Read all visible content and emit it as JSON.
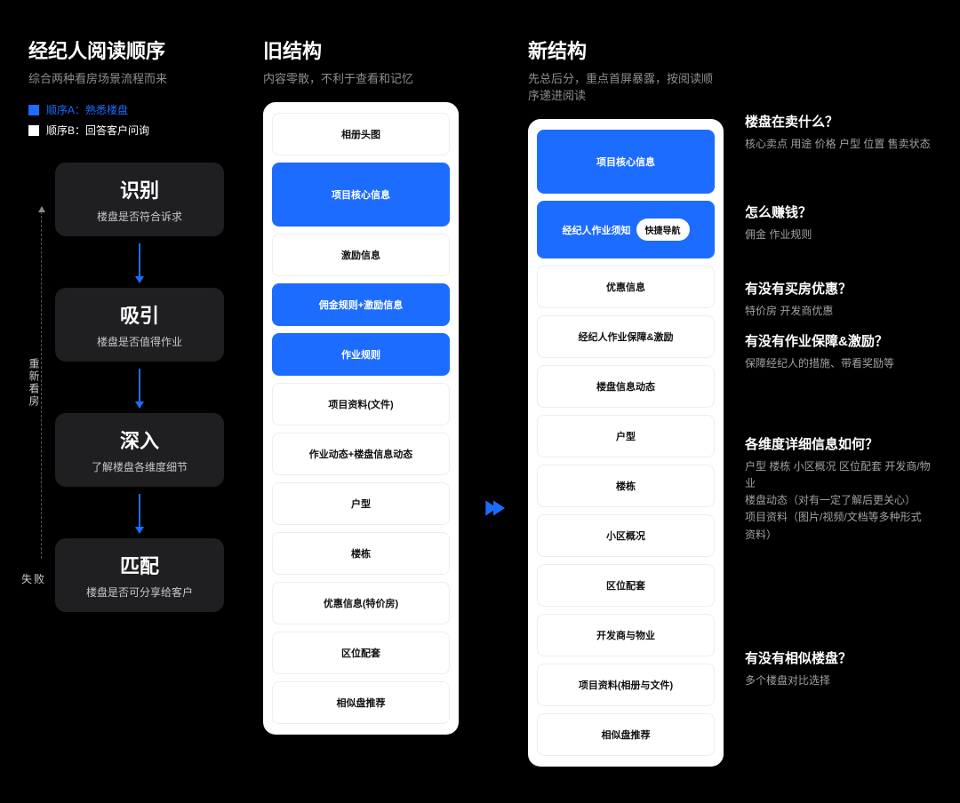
{
  "flow": {
    "title": "经纪人阅读顺序",
    "subtitle": "综合两种看房场景流程而来",
    "legend_a": "顺序A：熟悉楼盘",
    "legend_b": "顺序B：回答客户问询",
    "side_revisit": "重新看房",
    "side_fail": "失败",
    "nodes": [
      {
        "title": "识别",
        "desc": "楼盘是否符合诉求"
      },
      {
        "title": "吸引",
        "desc": "楼盘是否值得作业"
      },
      {
        "title": "深入",
        "desc": "了解楼盘各维度细节"
      },
      {
        "title": "匹配",
        "desc": "楼盘是否可分享给客户"
      }
    ]
  },
  "old": {
    "title": "旧结构",
    "subtitle": "内容零散，不利于查看和记忆",
    "items": [
      {
        "label": "相册头图",
        "style": "white"
      },
      {
        "label": "项目核心信息",
        "style": "blue-tall"
      },
      {
        "label": "激励信息",
        "style": "white"
      },
      {
        "label": "佣金规则+激励信息",
        "style": "blue"
      },
      {
        "label": "作业规则",
        "style": "blue"
      },
      {
        "label": "项目资料(文件)",
        "style": "white"
      },
      {
        "label": "作业动态+楼盘信息动态",
        "style": "white"
      },
      {
        "label": "户型",
        "style": "white"
      },
      {
        "label": "楼栋",
        "style": "white"
      },
      {
        "label": "优惠信息(特价房)",
        "style": "white"
      },
      {
        "label": "区位配套",
        "style": "white"
      },
      {
        "label": "相似盘推荐",
        "style": "white"
      }
    ]
  },
  "new": {
    "title": "新结构",
    "subtitle": "先总后分，重点首屏暴露，按阅读顺序递进阅读",
    "items": [
      {
        "label": "项目核心信息",
        "style": "blue-tall"
      },
      {
        "label": "经纪人作业须知",
        "style": "nav",
        "pill": "快捷导航"
      },
      {
        "label": "优惠信息",
        "style": "white"
      },
      {
        "label": "经纪人作业保障&激励",
        "style": "white"
      },
      {
        "label": "楼盘信息动态",
        "style": "white"
      },
      {
        "label": "户型",
        "style": "white"
      },
      {
        "label": "楼栋",
        "style": "white"
      },
      {
        "label": "小区概况",
        "style": "white"
      },
      {
        "label": "区位配套",
        "style": "white"
      },
      {
        "label": "开发商与物业",
        "style": "white"
      },
      {
        "label": "项目资料(相册与文件)",
        "style": "white"
      },
      {
        "label": "相似盘推荐",
        "style": "white"
      }
    ]
  },
  "questions": [
    {
      "title": "楼盘在卖什么？",
      "desc": "核心卖点 用途 价格 户型 位置 售卖状态",
      "sp": "q-sp-1"
    },
    {
      "title": "怎么赚钱？",
      "desc": "佣金 作业规则",
      "sp": "q-sp-2"
    },
    {
      "title": "有没有买房优惠？",
      "desc": "特价房 开发商优惠",
      "sp": "q-sp-3"
    },
    {
      "title": "有没有作业保障&激励？",
      "desc": "保障经纪人的措施、带看奖励等",
      "sp": "q-sp-4"
    },
    {
      "title": "各维度详细信息如何？",
      "desc": "户型 楼栋 小区概况 区位配套 开发商/物业\n楼盘动态（对有一定了解后更关心）\n项目资料（图片/视频/文档等多种形式资料）",
      "sp": "q-sp-5"
    },
    {
      "title": "有没有相似楼盘？",
      "desc": "多个楼盘对比选择",
      "sp": ""
    }
  ]
}
